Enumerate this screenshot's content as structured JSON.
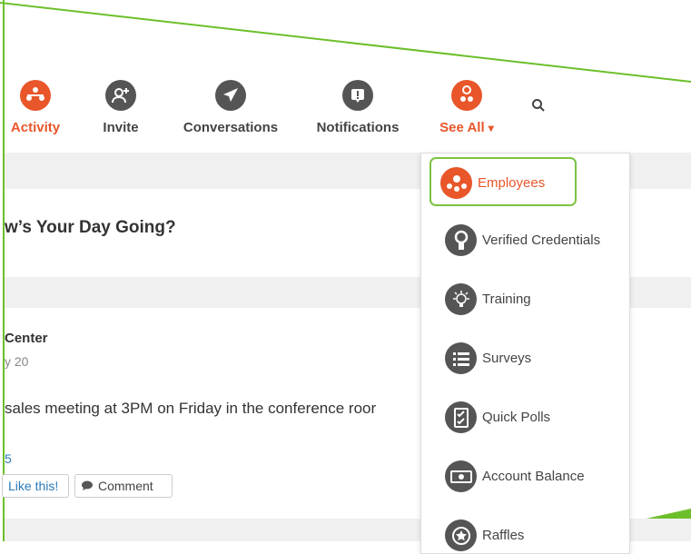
{
  "nav": {
    "items": [
      {
        "label": "Activity",
        "icon": "activity-icon"
      },
      {
        "label": "Invite",
        "icon": "add-user-icon"
      },
      {
        "label": "Conversations",
        "icon": "paper-plane-icon"
      },
      {
        "label": "Notifications",
        "icon": "alert-icon"
      },
      {
        "label": "See All",
        "icon": "gears-icon"
      }
    ],
    "caret": "▾"
  },
  "main": {
    "greeting": "w’s Your Day Going?",
    "post": {
      "author": "Center",
      "date": "y 20",
      "text": "sales meeting at 3PM on Friday in the conference roor",
      "count": "5",
      "like_label": "Like this!",
      "comment_label": "Comment"
    }
  },
  "dropdown": {
    "items": [
      {
        "label": "Employees",
        "icon": "employees-icon",
        "active": true
      },
      {
        "label": "Verified Credentials",
        "icon": "credentials-icon"
      },
      {
        "label": "Training",
        "icon": "lightbulb-icon"
      },
      {
        "label": "Surveys",
        "icon": "list-icon"
      },
      {
        "label": "Quick Polls",
        "icon": "checklist-icon"
      },
      {
        "label": "Account Balance",
        "icon": "money-icon"
      },
      {
        "label": "Raffles",
        "icon": "star-badge-icon"
      }
    ]
  },
  "colors": {
    "accent": "#e8562a",
    "icon_gray": "#555555",
    "highlight": "#7cc242",
    "link": "#2a7ab8"
  }
}
